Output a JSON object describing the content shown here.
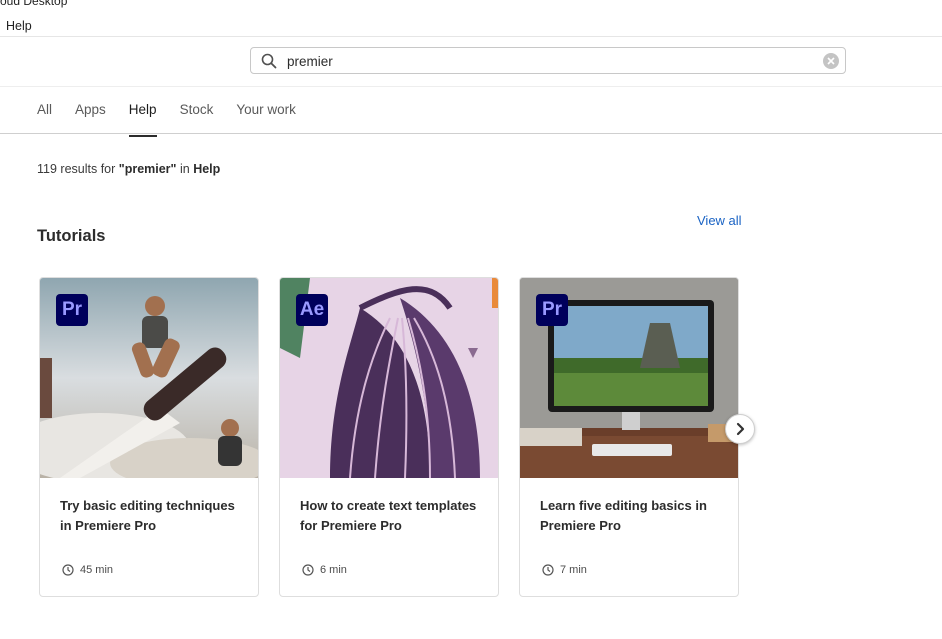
{
  "window": {
    "title": "oud Desktop"
  },
  "menu": {
    "help": "Help"
  },
  "search": {
    "value": "premier",
    "placeholder": ""
  },
  "tabs": [
    {
      "label": "All"
    },
    {
      "label": "Apps"
    },
    {
      "label": "Help",
      "active": true
    },
    {
      "label": "Stock"
    },
    {
      "label": "Your work"
    }
  ],
  "results": {
    "count_text": "119 results for",
    "query": "\"premier\"",
    "in_text": "in",
    "scope": "Help"
  },
  "section": {
    "title": "Tutorials",
    "view_all": "View all"
  },
  "cards": [
    {
      "badge": "Pr",
      "title": "Try basic editing techniques in Premiere Pro",
      "duration": "45 min"
    },
    {
      "badge": "Ae",
      "title": "How to create text templates for Premiere Pro",
      "duration": "6 min"
    },
    {
      "badge": "Pr",
      "title": "Learn five editing basics in Premiere Pro",
      "duration": "7 min"
    }
  ],
  "colors": {
    "accent_link": "#1a63c4",
    "badge_bg": "#00005b",
    "badge_fg": "#9999ff"
  },
  "icons": {
    "search": "search-icon",
    "clear": "clear-icon",
    "clock": "clock-icon",
    "next": "chevron-right-icon"
  }
}
